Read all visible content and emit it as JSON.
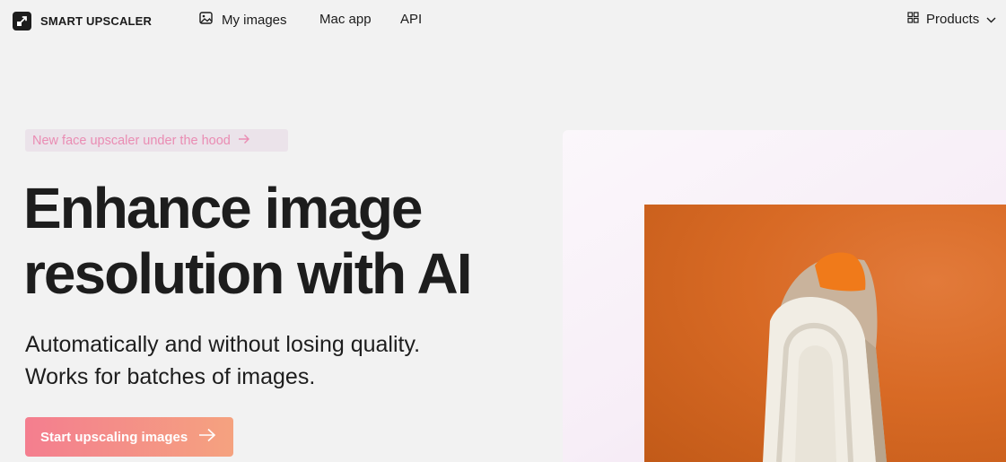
{
  "brand": {
    "name": "SMART UPSCALER",
    "icon": "upscale-arrow-icon"
  },
  "nav": {
    "links": [
      {
        "label": "My images",
        "icon": "image-gallery-icon"
      },
      {
        "label": "Mac app"
      },
      {
        "label": "API"
      }
    ],
    "products": {
      "label": "Products",
      "icon": "grid-icon",
      "caret": "chevron-down-icon"
    }
  },
  "hero": {
    "badge": {
      "label": "New face upscaler under the hood",
      "icon": "arrow-right-icon"
    },
    "headline_line1": "Enhance image",
    "headline_line2": "resolution with AI",
    "subtitle_line1": "Automatically and without losing quality.",
    "subtitle_line2": "Works for batches of images.",
    "cta": {
      "label": "Start upscaling images",
      "icon": "arrow-right-icon"
    }
  },
  "colors": {
    "background": "#f2f2f2",
    "text": "#1d1d1d",
    "badge_bg": "#ebe3ea",
    "badge_text": "#ea8cb3",
    "cta_gradient_start": "#f47e8f",
    "cta_gradient_end": "#f5a27f",
    "photo_orange": "#d86a25"
  }
}
